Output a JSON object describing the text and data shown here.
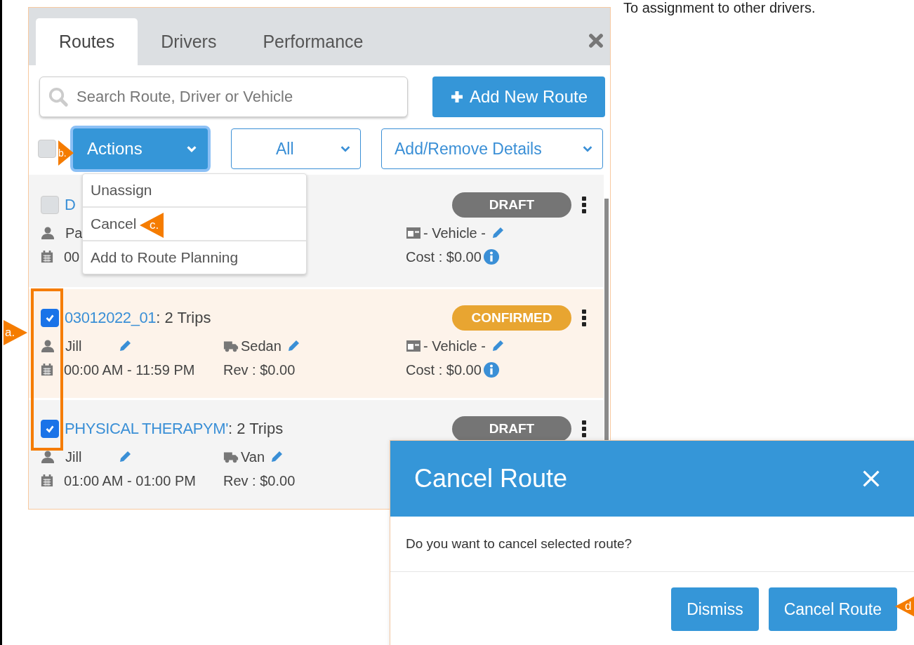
{
  "caption": "To assignment to other drivers.",
  "tabs": [
    {
      "label": "Routes",
      "selected": true
    },
    {
      "label": "Drivers",
      "selected": false
    },
    {
      "label": "Performance",
      "selected": false
    }
  ],
  "search": {
    "placeholder": "Search Route, Driver or Vehicle"
  },
  "add_button": {
    "label": "Add New Route"
  },
  "select_all": {
    "checked": false
  },
  "actions": {
    "label": "Actions",
    "open": true
  },
  "filters": [
    {
      "label": "All"
    },
    {
      "label": "Add/Remove Details"
    }
  ],
  "menu": [
    {
      "label": "Unassign"
    },
    {
      "label": "Cancel"
    },
    {
      "label": "Add to Route Planning"
    }
  ],
  "routes": [
    {
      "checked": false,
      "highlighted": false,
      "name": "D",
      "status": "DRAFT",
      "color": "#757575",
      "driver": {
        "text": "Pa"
      },
      "time": "00",
      "vehicle": "- Vehicle -",
      "cost": "Cost : $0.00"
    },
    {
      "checked": true,
      "highlighted": true,
      "name": "03012022_01",
      "trips": ": 2 Trips",
      "status": "CONFIRMED",
      "color": "#e8a531",
      "driver": {
        "text": "Jill",
        "editable": true
      },
      "vehicle_type": "Sedan",
      "time": "00:00 AM - 11:59 PM",
      "rev": "Rev : $0.00",
      "vehicle": "- Vehicle -",
      "cost": "Cost : $0.00"
    },
    {
      "checked": true,
      "highlighted": false,
      "name": "PHYSICAL THERAPYM'",
      "trips": ": 2 Trips",
      "status": "DRAFT",
      "color": "#757575",
      "driver": {
        "text": "Jill",
        "editable": true
      },
      "vehicle_type": "Van",
      "time": "01:00 AM - 01:00 PM",
      "rev": "Rev : $0.00"
    }
  ],
  "dialog": {
    "title": "Cancel Route",
    "message": "Do you want to cancel selected route?",
    "buttons": [
      "Dismiss",
      "Cancel Route"
    ]
  },
  "annotations": [
    {
      "label": "a."
    },
    {
      "label": "b."
    },
    {
      "label": "c."
    },
    {
      "label": "d"
    }
  ]
}
